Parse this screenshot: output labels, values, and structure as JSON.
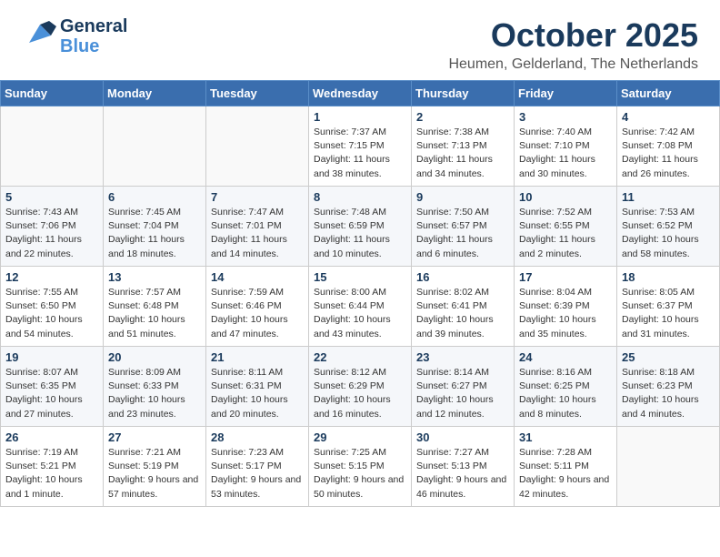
{
  "header": {
    "logo_line1": "General",
    "logo_line2": "Blue",
    "month": "October 2025",
    "location": "Heumen, Gelderland, The Netherlands"
  },
  "weekdays": [
    "Sunday",
    "Monday",
    "Tuesday",
    "Wednesday",
    "Thursday",
    "Friday",
    "Saturday"
  ],
  "weeks": [
    [
      {
        "day": "",
        "info": ""
      },
      {
        "day": "",
        "info": ""
      },
      {
        "day": "",
        "info": ""
      },
      {
        "day": "1",
        "info": "Sunrise: 7:37 AM\nSunset: 7:15 PM\nDaylight: 11 hours\nand 38 minutes."
      },
      {
        "day": "2",
        "info": "Sunrise: 7:38 AM\nSunset: 7:13 PM\nDaylight: 11 hours\nand 34 minutes."
      },
      {
        "day": "3",
        "info": "Sunrise: 7:40 AM\nSunset: 7:10 PM\nDaylight: 11 hours\nand 30 minutes."
      },
      {
        "day": "4",
        "info": "Sunrise: 7:42 AM\nSunset: 7:08 PM\nDaylight: 11 hours\nand 26 minutes."
      }
    ],
    [
      {
        "day": "5",
        "info": "Sunrise: 7:43 AM\nSunset: 7:06 PM\nDaylight: 11 hours\nand 22 minutes."
      },
      {
        "day": "6",
        "info": "Sunrise: 7:45 AM\nSunset: 7:04 PM\nDaylight: 11 hours\nand 18 minutes."
      },
      {
        "day": "7",
        "info": "Sunrise: 7:47 AM\nSunset: 7:01 PM\nDaylight: 11 hours\nand 14 minutes."
      },
      {
        "day": "8",
        "info": "Sunrise: 7:48 AM\nSunset: 6:59 PM\nDaylight: 11 hours\nand 10 minutes."
      },
      {
        "day": "9",
        "info": "Sunrise: 7:50 AM\nSunset: 6:57 PM\nDaylight: 11 hours\nand 6 minutes."
      },
      {
        "day": "10",
        "info": "Sunrise: 7:52 AM\nSunset: 6:55 PM\nDaylight: 11 hours\nand 2 minutes."
      },
      {
        "day": "11",
        "info": "Sunrise: 7:53 AM\nSunset: 6:52 PM\nDaylight: 10 hours\nand 58 minutes."
      }
    ],
    [
      {
        "day": "12",
        "info": "Sunrise: 7:55 AM\nSunset: 6:50 PM\nDaylight: 10 hours\nand 54 minutes."
      },
      {
        "day": "13",
        "info": "Sunrise: 7:57 AM\nSunset: 6:48 PM\nDaylight: 10 hours\nand 51 minutes."
      },
      {
        "day": "14",
        "info": "Sunrise: 7:59 AM\nSunset: 6:46 PM\nDaylight: 10 hours\nand 47 minutes."
      },
      {
        "day": "15",
        "info": "Sunrise: 8:00 AM\nSunset: 6:44 PM\nDaylight: 10 hours\nand 43 minutes."
      },
      {
        "day": "16",
        "info": "Sunrise: 8:02 AM\nSunset: 6:41 PM\nDaylight: 10 hours\nand 39 minutes."
      },
      {
        "day": "17",
        "info": "Sunrise: 8:04 AM\nSunset: 6:39 PM\nDaylight: 10 hours\nand 35 minutes."
      },
      {
        "day": "18",
        "info": "Sunrise: 8:05 AM\nSunset: 6:37 PM\nDaylight: 10 hours\nand 31 minutes."
      }
    ],
    [
      {
        "day": "19",
        "info": "Sunrise: 8:07 AM\nSunset: 6:35 PM\nDaylight: 10 hours\nand 27 minutes."
      },
      {
        "day": "20",
        "info": "Sunrise: 8:09 AM\nSunset: 6:33 PM\nDaylight: 10 hours\nand 23 minutes."
      },
      {
        "day": "21",
        "info": "Sunrise: 8:11 AM\nSunset: 6:31 PM\nDaylight: 10 hours\nand 20 minutes."
      },
      {
        "day": "22",
        "info": "Sunrise: 8:12 AM\nSunset: 6:29 PM\nDaylight: 10 hours\nand 16 minutes."
      },
      {
        "day": "23",
        "info": "Sunrise: 8:14 AM\nSunset: 6:27 PM\nDaylight: 10 hours\nand 12 minutes."
      },
      {
        "day": "24",
        "info": "Sunrise: 8:16 AM\nSunset: 6:25 PM\nDaylight: 10 hours\nand 8 minutes."
      },
      {
        "day": "25",
        "info": "Sunrise: 8:18 AM\nSunset: 6:23 PM\nDaylight: 10 hours\nand 4 minutes."
      }
    ],
    [
      {
        "day": "26",
        "info": "Sunrise: 7:19 AM\nSunset: 5:21 PM\nDaylight: 10 hours\nand 1 minute."
      },
      {
        "day": "27",
        "info": "Sunrise: 7:21 AM\nSunset: 5:19 PM\nDaylight: 9 hours\nand 57 minutes."
      },
      {
        "day": "28",
        "info": "Sunrise: 7:23 AM\nSunset: 5:17 PM\nDaylight: 9 hours\nand 53 minutes."
      },
      {
        "day": "29",
        "info": "Sunrise: 7:25 AM\nSunset: 5:15 PM\nDaylight: 9 hours\nand 50 minutes."
      },
      {
        "day": "30",
        "info": "Sunrise: 7:27 AM\nSunset: 5:13 PM\nDaylight: 9 hours\nand 46 minutes."
      },
      {
        "day": "31",
        "info": "Sunrise: 7:28 AM\nSunset: 5:11 PM\nDaylight: 9 hours\nand 42 minutes."
      },
      {
        "day": "",
        "info": ""
      }
    ]
  ]
}
